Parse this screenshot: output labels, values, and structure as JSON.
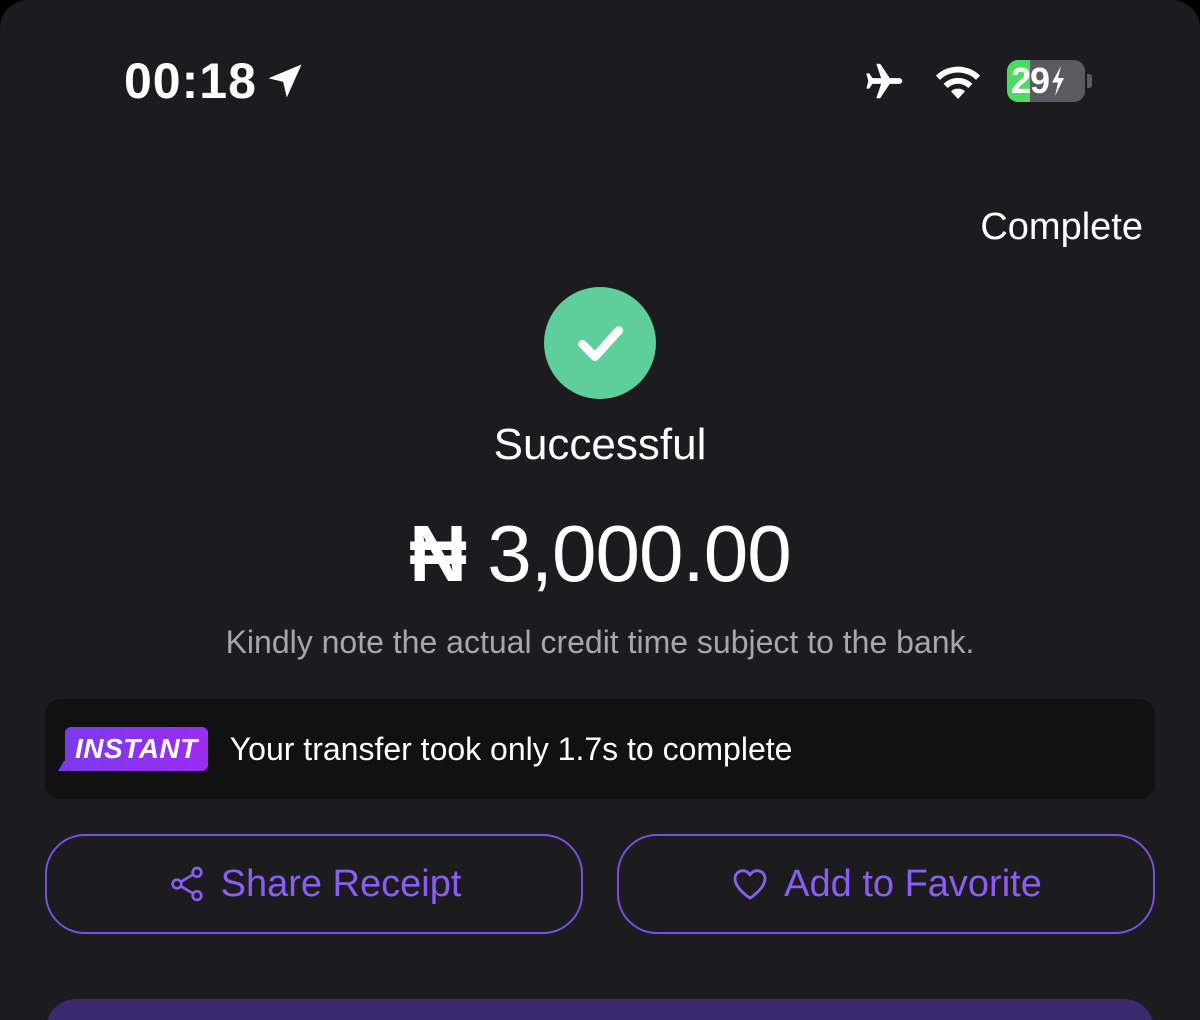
{
  "status_bar": {
    "time": "00:18",
    "location_icon": "location-arrow-icon",
    "airplane_icon": "airplane-icon",
    "wifi_icon": "wifi-icon",
    "battery_percent": "29",
    "battery_level": 0.29,
    "battery_charging": true,
    "battery_color": "#4cd964"
  },
  "header": {
    "complete_label": "Complete"
  },
  "result": {
    "status_icon": "check-icon",
    "status_color": "#5ecf9a",
    "status_label": "Successful",
    "currency_symbol": "₦",
    "amount": "3,000.00",
    "note": "Kindly note the actual credit time subject to the bank."
  },
  "instant_banner": {
    "tag": "INSTANT",
    "message": "Your transfer took only 1.7s to complete"
  },
  "actions": {
    "share_label": "Share Receipt",
    "share_icon": "share-icon",
    "favorite_label": "Add to Favorite",
    "favorite_icon": "heart-icon",
    "accent_color": "#7b4ee8"
  }
}
